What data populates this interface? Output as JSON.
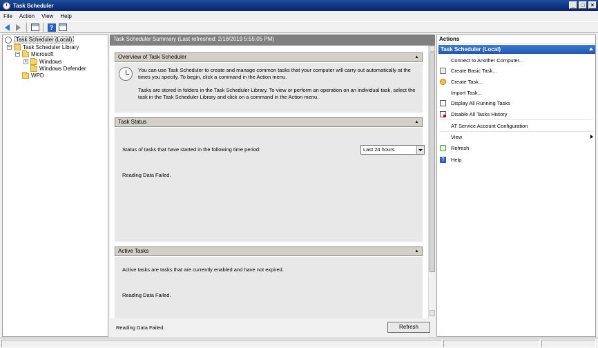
{
  "window": {
    "title": "Task Scheduler"
  },
  "menu": [
    "File",
    "Action",
    "View",
    "Help"
  ],
  "tree": {
    "root": "Task Scheduler (Local)",
    "library": "Task Scheduler Library",
    "microsoft": "Microsoft",
    "windows": "Windows",
    "windows_defender": "Windows Defender",
    "wpd": "WPD"
  },
  "center": {
    "header": "Task Scheduler Summary (Last refreshed: 2/18/2019 5:55:05 PM)",
    "overview": {
      "title": "Overview of Task Scheduler",
      "para1": "You can use Task Scheduler to create and manage common tasks that your computer will carry out automatically at the times you specify. To begin, click a command in the Action menu.",
      "para2": "Tasks are stored in folders in the Task Scheduler Library. To view or perform an operation on an individual task, select the task in the Task Scheduler Library and click on a command in the Action menu."
    },
    "task_status": {
      "title": "Task Status",
      "label": "Status of tasks that have started in the following time period:",
      "period": "Last 24 hours",
      "message": "Reading Data Failed."
    },
    "active_tasks": {
      "title": "Active Tasks",
      "description": "Active tasks are tasks that are currently enabled and have not expired.",
      "message": "Reading Data Failed."
    },
    "footer": {
      "message": "Reading Data Failed.",
      "refresh_label": "Refresh"
    }
  },
  "actions": {
    "title": "Actions",
    "group": "Task Scheduler (Local)",
    "items": [
      {
        "label": "Connect to Another Computer...",
        "icon": "none"
      },
      {
        "label": "Create Basic Task...",
        "icon": "basic-task-icon"
      },
      {
        "label": "Create Task...",
        "icon": "create-task-icon"
      },
      {
        "label": "Import Task...",
        "icon": "none"
      },
      {
        "label": "Display All Running Tasks",
        "icon": "running-tasks-icon"
      },
      {
        "label": "Disable All Tasks History",
        "icon": "disable-history-icon"
      },
      {
        "label": "AT Service Account Configuration",
        "icon": "none"
      },
      {
        "label": "View",
        "icon": "none"
      },
      {
        "label": "Refresh",
        "icon": "refresh-icon"
      },
      {
        "label": "Help",
        "icon": "help-icon"
      }
    ]
  }
}
